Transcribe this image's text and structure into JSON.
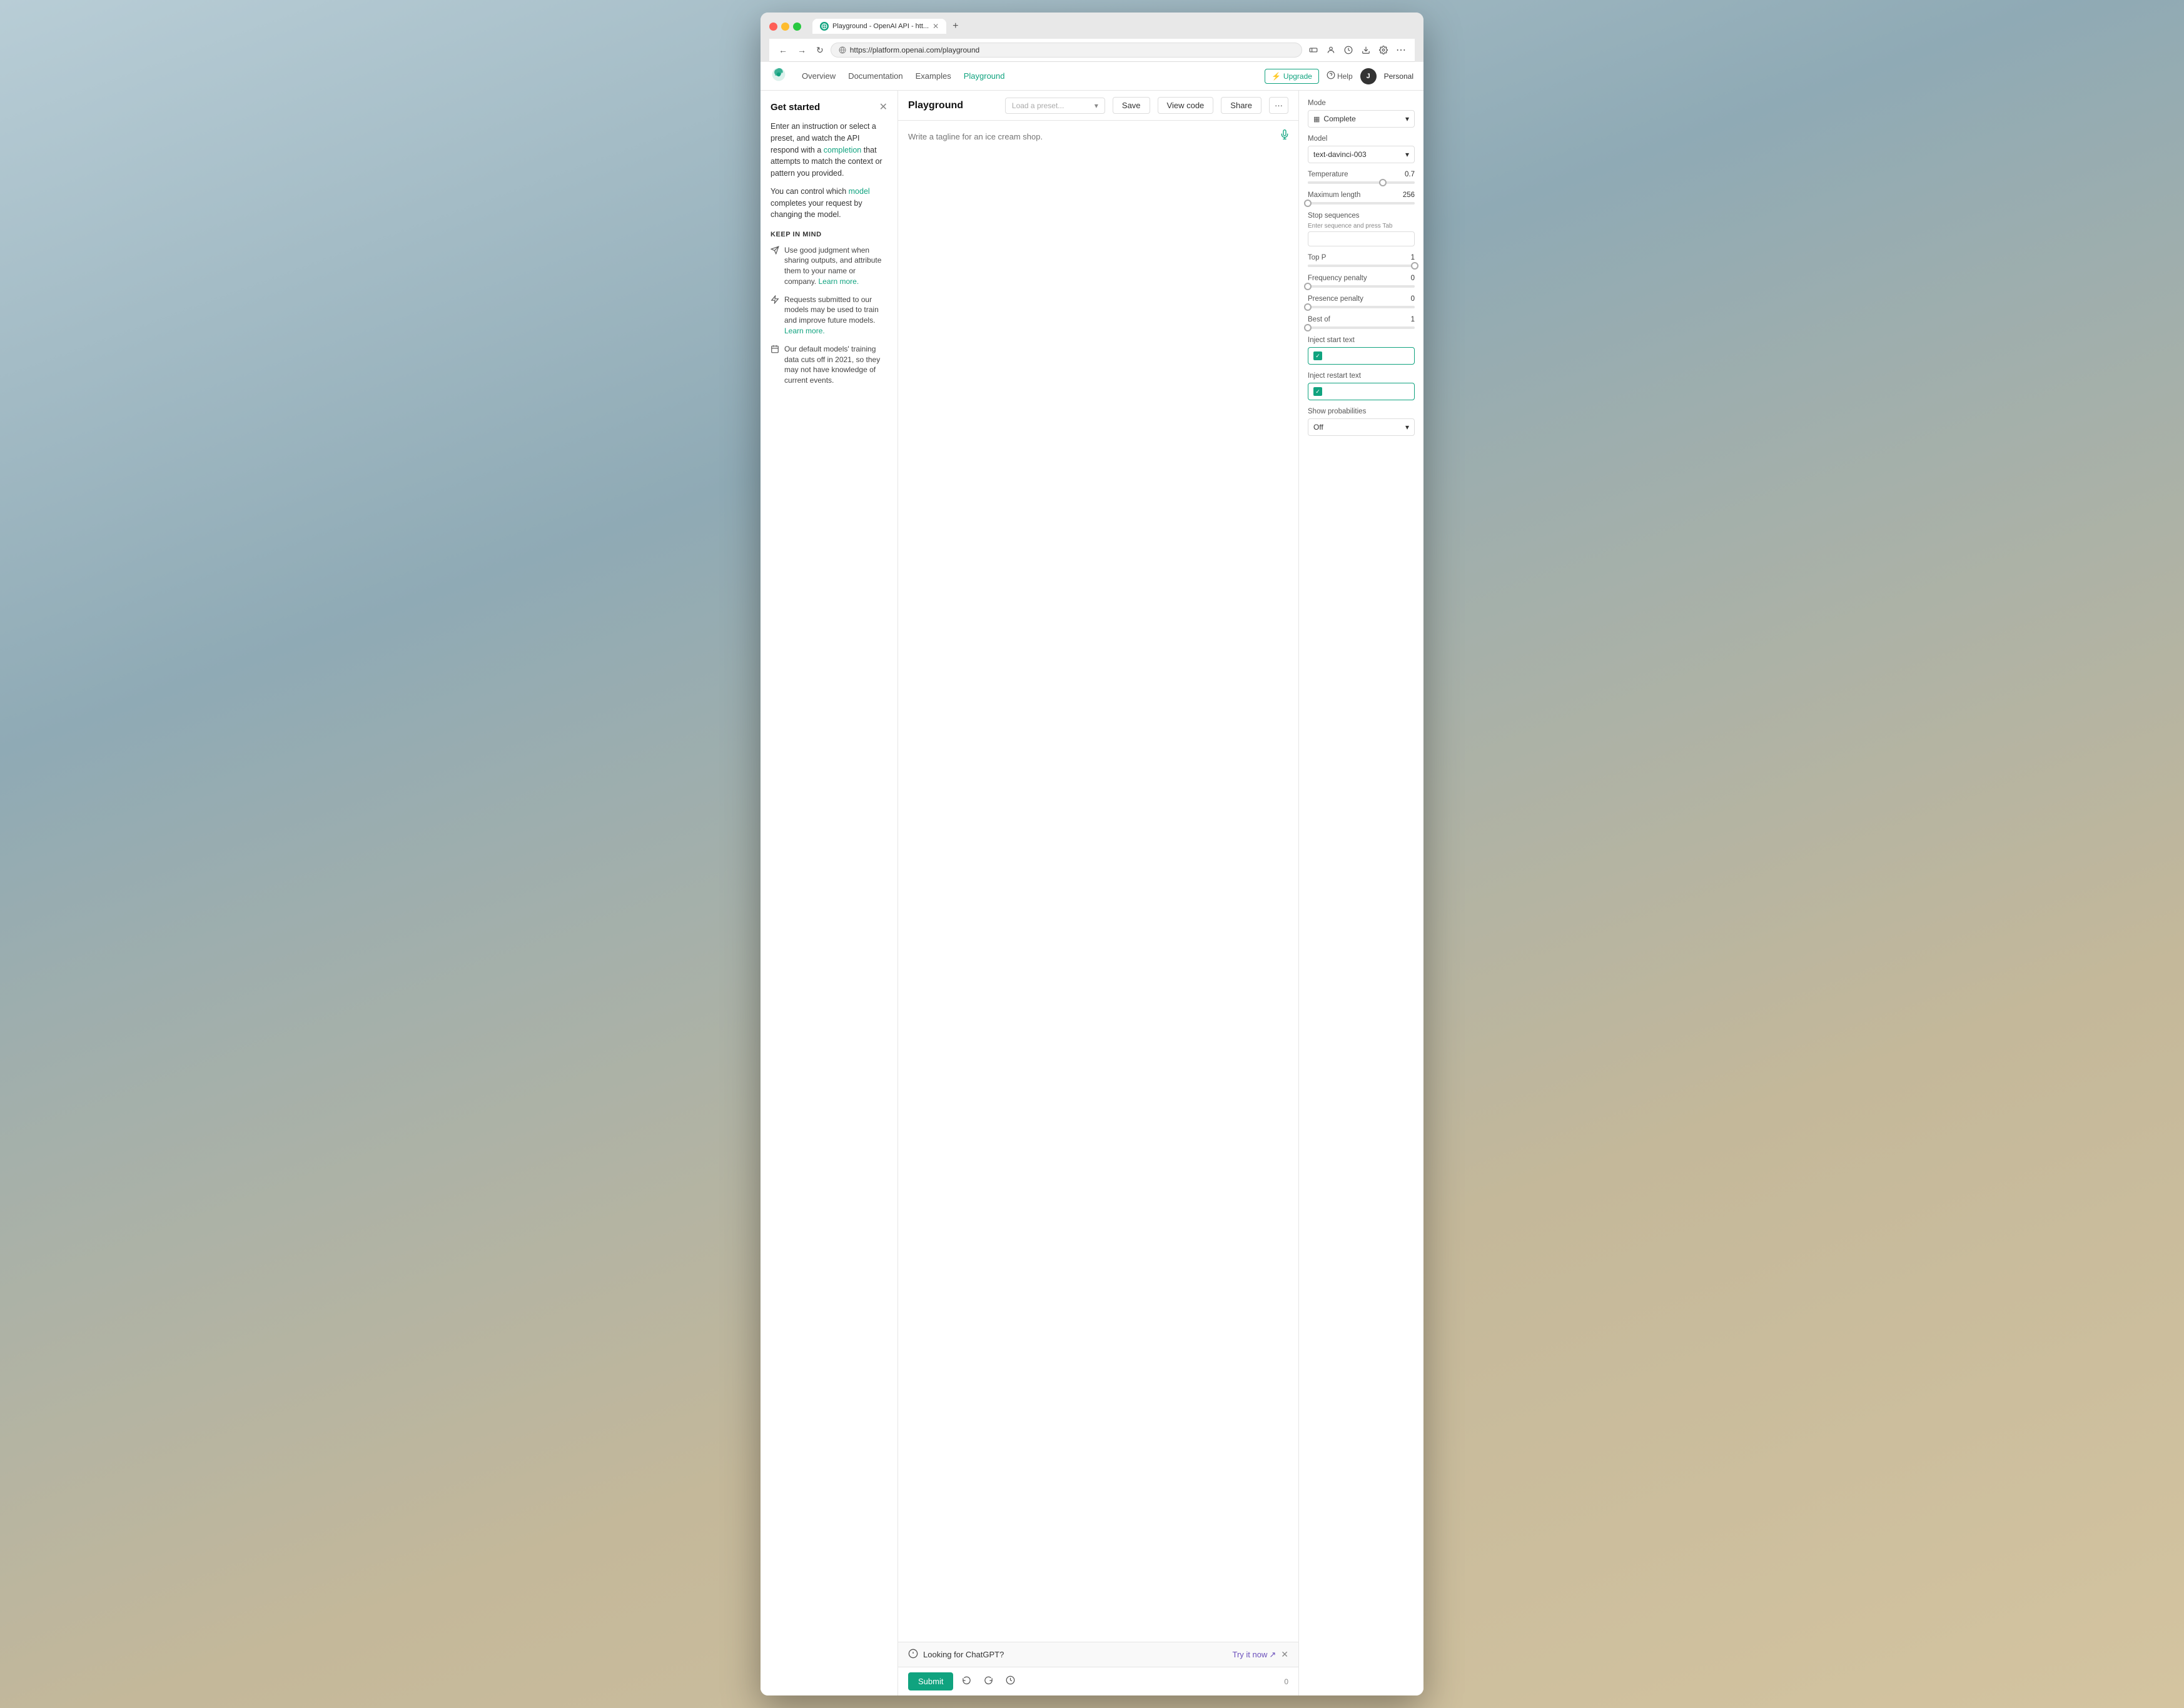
{
  "browser": {
    "url": "https://platform.openai.com/playground",
    "tab_title": "Playground - OpenAI API - htt...",
    "back_icon": "←",
    "forward_icon": "→",
    "refresh_icon": "↻"
  },
  "topnav": {
    "links": [
      "Overview",
      "Documentation",
      "Examples",
      "Playground"
    ],
    "active_link": "Playground",
    "upgrade_label": "Upgrade",
    "help_label": "Help",
    "personal_label": "Personal",
    "avatar_initial": "J"
  },
  "sidebar": {
    "title": "Get started",
    "description1": "Enter an instruction or select a preset, and watch the API respond with a",
    "completion_link": "completion",
    "description1b": "that attempts to match the context or pattern you provided.",
    "description2": "You can control which",
    "model_link": "model",
    "description2b": "completes your request by changing the model.",
    "section_title": "KEEP IN MIND",
    "items": [
      {
        "icon": "➤",
        "text": "Use good judgment when sharing outputs, and attribute them to your name or company.",
        "link_text": "Learn more.",
        "link": "#"
      },
      {
        "icon": "⚡",
        "text": "Requests submitted to our models may be used to train and improve future models.",
        "link_text": "Learn more.",
        "link": "#"
      },
      {
        "icon": "📅",
        "text": "Our default models' training data cuts off in 2021, so they may not have knowledge of current events.",
        "link_text": "",
        "link": ""
      }
    ]
  },
  "playground": {
    "title": "Playground",
    "preset_placeholder": "Load a preset...",
    "save_label": "Save",
    "view_code_label": "View code",
    "share_label": "Share",
    "more_icon": "···",
    "textarea_placeholder": "Write a tagline for an ice cream shop.",
    "submit_label": "Submit",
    "char_count": "0",
    "banner": {
      "text": "Looking for ChatGPT?",
      "link_text": "Try it now",
      "link_icon": "↗"
    }
  },
  "settings": {
    "mode_label": "Mode",
    "mode_value": "Complete",
    "mode_icon": "▦",
    "model_label": "Model",
    "model_value": "text-davinci-003",
    "temperature_label": "Temperature",
    "temperature_value": "0.7",
    "temperature_pct": 70,
    "max_length_label": "Maximum length",
    "max_length_value": "256",
    "max_length_pct": 0,
    "stop_seq_label": "Stop sequences",
    "stop_seq_hint": "Enter sequence and press Tab",
    "top_p_label": "Top P",
    "top_p_value": "1",
    "top_p_pct": 100,
    "freq_penalty_label": "Frequency penalty",
    "freq_penalty_value": "0",
    "freq_penalty_pct": 0,
    "presence_penalty_label": "Presence penalty",
    "presence_penalty_value": "0",
    "presence_penalty_pct": 0,
    "best_of_label": "Best of",
    "best_of_value": "1",
    "best_of_pct": 0,
    "inject_start_label": "Inject start text",
    "inject_restart_label": "Inject restart text",
    "show_prob_label": "Show probabilities",
    "show_prob_value": "Off"
  }
}
